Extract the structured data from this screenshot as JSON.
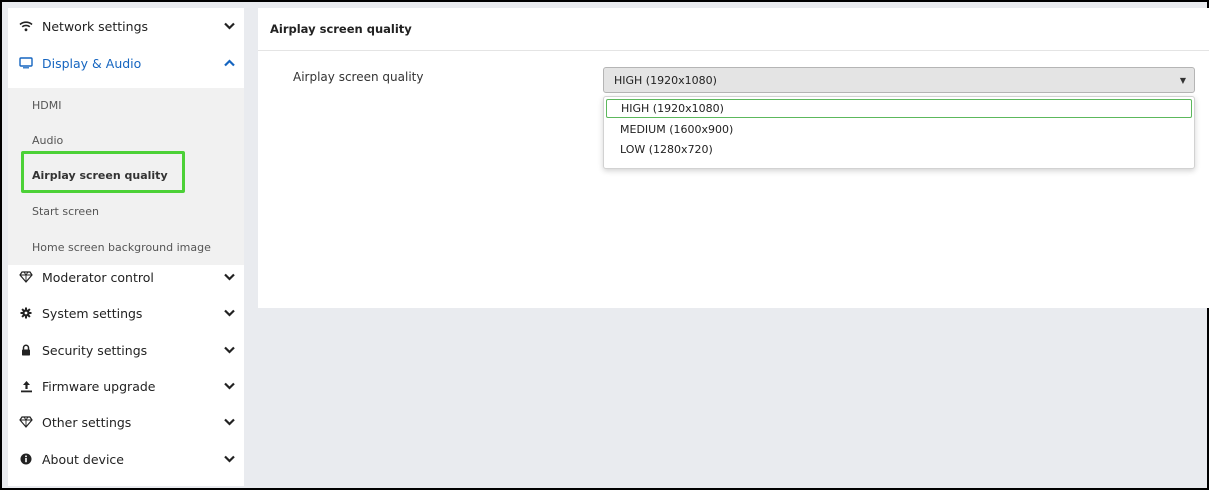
{
  "sidebar": {
    "items": [
      {
        "label": "Network settings",
        "icon": "wifi-icon",
        "chevron": "chevron-down-icon"
      },
      {
        "label": "Display & Audio",
        "icon": "monitor-icon",
        "chevron": "chevron-up-icon",
        "active": true
      },
      {
        "label": "Moderator control",
        "icon": "diamond-icon",
        "chevron": "chevron-down-icon"
      },
      {
        "label": "System settings",
        "icon": "gear-icon",
        "chevron": "chevron-down-icon"
      },
      {
        "label": "Security settings",
        "icon": "lock-icon",
        "chevron": "chevron-down-icon"
      },
      {
        "label": "Firmware upgrade",
        "icon": "upload-icon",
        "chevron": "chevron-down-icon"
      },
      {
        "label": "Other settings",
        "icon": "diamond-icon",
        "chevron": "chevron-down-icon"
      },
      {
        "label": "About device",
        "icon": "info-icon",
        "chevron": "chevron-down-icon"
      }
    ],
    "submenu": [
      {
        "label": "HDMI"
      },
      {
        "label": "Audio"
      },
      {
        "label": "Airplay screen quality",
        "selected": true
      },
      {
        "label": "Start screen"
      },
      {
        "label": "Home screen background image"
      }
    ]
  },
  "panel": {
    "title": "Airplay screen quality",
    "field_label": "Airplay screen quality",
    "select_value": "HIGH (1920x1080)",
    "options": [
      "HIGH (1920x1080)",
      "MEDIUM (1600x900)",
      "LOW (1280x720)"
    ]
  },
  "colors": {
    "accent": "#1565c0",
    "highlight_green": "#4cd137",
    "option_border": "#5cb85c",
    "background": "#e9ebef"
  }
}
